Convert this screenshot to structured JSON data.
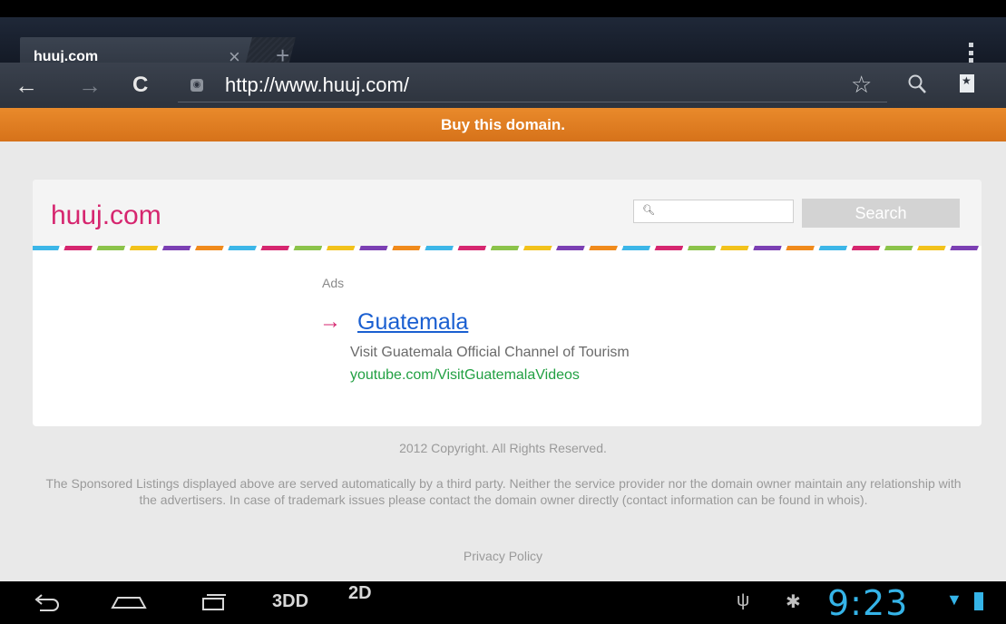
{
  "browser": {
    "tab_title": "huuj.com",
    "tab_close_glyph": "×",
    "new_tab_glyph": "+",
    "back_glyph": "←",
    "forward_glyph": "→",
    "reload_glyph": "C",
    "url": "http://www.huuj.com/",
    "star_glyph": "☆",
    "icons": [
      "menu-icon",
      "back-arrow-icon",
      "forward-arrow-icon",
      "reload-icon",
      "site-globe-icon",
      "bookmark-star-icon",
      "search-icon",
      "bookmarks-icon"
    ]
  },
  "banner": {
    "text": "Buy this domain.",
    "color": "#e37f23"
  },
  "page": {
    "site_title": "huuj.com",
    "search_placeholder": "",
    "search_button": "Search",
    "ads_label": "Ads",
    "ad": {
      "arrow": "→",
      "title": "Guatemala",
      "description": "Visit Guatemala Official Channel of Tourism",
      "url": "youtube.com/VisitGuatemalaVideos"
    },
    "copyright": "2012 Copyright. All Rights Reserved.",
    "disclaimer": "The Sponsored Listings displayed above are served automatically by a third party. Neither the service provider nor the domain owner maintain any relationship with the advertisers. In case of trademark issues please contact the domain owner directly (contact information can be found in whois).",
    "privacy": "Privacy Policy",
    "accent_color": "#d6266f",
    "link_color": "#1a5fd1",
    "url_color": "#22a043"
  },
  "system_bar": {
    "back_glyph": "⟲",
    "label_3d": "3DD",
    "label_2d": "2D",
    "usb_glyph": "ψ",
    "debug_glyph": "✱",
    "clock": "9:23",
    "wifi_glyph": "▼",
    "clock_color": "#35b4e8"
  }
}
